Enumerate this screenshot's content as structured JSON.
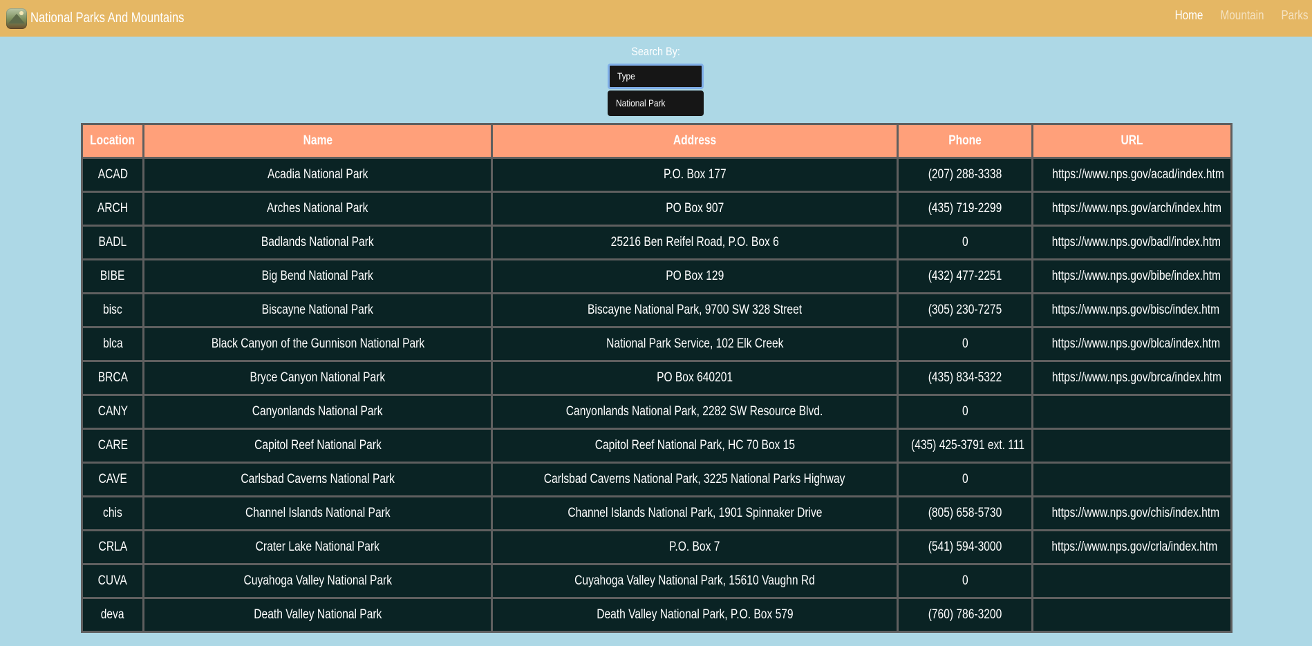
{
  "navbar": {
    "brand_title": "National Parks And Mountains",
    "links": [
      {
        "label": "Home",
        "active": true
      },
      {
        "label": "Mountain",
        "active": false
      },
      {
        "label": "Parks",
        "active": false
      }
    ],
    "color": "#e5b764"
  },
  "search": {
    "label": "Search By:",
    "type_value": "Type",
    "park_value": "National Park"
  },
  "table": {
    "headers": [
      "Location",
      "Name",
      "Address",
      "Phone",
      "URL"
    ],
    "rows": [
      [
        "ACAD",
        "Acadia National Park",
        "P.O. Box 177",
        "(207) 288-3338",
        "https://www.nps.gov/acad/index.htm"
      ],
      [
        "ARCH",
        "Arches National Park",
        "PO Box 907",
        "(435) 719-2299",
        "https://www.nps.gov/arch/index.htm"
      ],
      [
        "BADL",
        "Badlands National Park",
        "25216 Ben Reifel Road, P.O. Box 6",
        "0",
        "https://www.nps.gov/badl/index.htm"
      ],
      [
        "BIBE",
        "Big Bend National Park",
        "PO Box 129",
        "(432) 477-2251",
        "https://www.nps.gov/bibe/index.htm"
      ],
      [
        "bisc",
        "Biscayne National Park",
        "Biscayne National Park, 9700 SW 328 Street",
        "(305) 230-7275",
        "https://www.nps.gov/bisc/index.htm"
      ],
      [
        "blca",
        "Black Canyon of the Gunnison National Park",
        "National Park Service, 102 Elk Creek",
        "0",
        "https://www.nps.gov/blca/index.htm"
      ],
      [
        "BRCA",
        "Bryce Canyon National Park",
        "PO Box 640201",
        "(435) 834-5322",
        "https://www.nps.gov/brca/index.htm"
      ],
      [
        "CANY",
        "Canyonlands National Park",
        "Canyonlands National Park, 2282 SW Resource Blvd.",
        "0",
        ""
      ],
      [
        "CARE",
        "Capitol Reef National Park",
        "Capitol Reef National Park, HC 70 Box 15",
        "(435) 425-3791 ext. 111",
        ""
      ],
      [
        "CAVE",
        "Carlsbad Caverns National Park",
        "Carlsbad Caverns National Park, 3225 National Parks Highway",
        "0",
        ""
      ],
      [
        "chis",
        "Channel Islands National Park",
        "Channel Islands National Park, 1901 Spinnaker Drive",
        "(805) 658-5730",
        "https://www.nps.gov/chis/index.htm"
      ],
      [
        "CRLA",
        "Crater Lake National Park",
        "P.O. Box 7",
        "(541) 594-3000",
        "https://www.nps.gov/crla/index.htm"
      ],
      [
        "CUVA",
        "Cuyahoga Valley National Park",
        "Cuyahoga Valley National Park, 15610 Vaughn Rd",
        "0",
        ""
      ],
      [
        "deva",
        "Death Valley National Park",
        "Death Valley National Park, P.O. Box 579",
        "(760) 786-3200",
        ""
      ]
    ],
    "header_color": "#ffa07a",
    "row_color": "#0a2324"
  },
  "page": {
    "background": "#add8e6"
  }
}
